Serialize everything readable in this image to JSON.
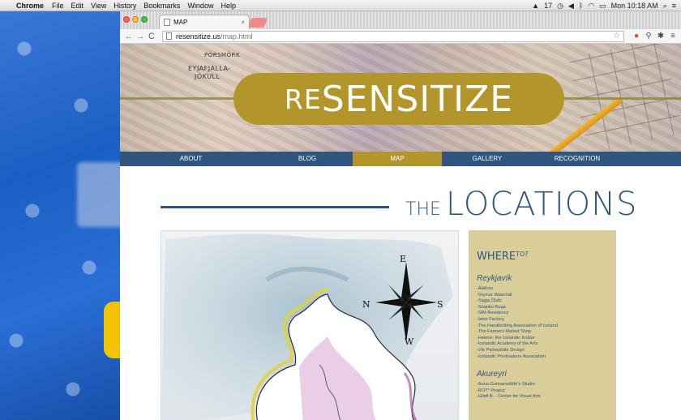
{
  "menubar": {
    "apple_glyph": "",
    "app_name": "Chrome",
    "menus": [
      "File",
      "Edit",
      "View",
      "History",
      "Bookmarks",
      "Window",
      "Help"
    ],
    "status_items": [
      "17",
      "Mon 10:18 AM"
    ]
  },
  "browser": {
    "tab": {
      "title": "MAP",
      "close_glyph": "×"
    },
    "nav": {
      "back": "←",
      "forward": "→",
      "reload": "C"
    },
    "url": {
      "host": "resensitize.us",
      "path": "/map.html"
    },
    "icons": {
      "star": "☆"
    }
  },
  "site": {
    "logo_prefix": "RE",
    "logo_main": "SENSITIZE",
    "banner_map_labels": [
      "PÓRSMÖRK",
      "EYJAFJALLA-",
      "JÖKULL"
    ],
    "nav": [
      "ABOUT",
      "BLOG",
      "MAP",
      "GALLERY",
      "RECOGNITION"
    ],
    "active_nav": "MAP",
    "heading": {
      "the": "THE",
      "title": "LOCATIONS"
    },
    "map_compass": {
      "n": "N",
      "e": "E",
      "s": "S",
      "w": "W"
    },
    "sidebar": {
      "title_main": "WHERE",
      "title_sup": "TO?",
      "sections": [
        {
          "city": "Reykjavík",
          "items": [
            "-Álafoss",
            "-Glymur Waterfall",
            "-Sigga Ólafs",
            "-Shanko Ruga",
            "-SIM Residency",
            "-Ístex Factory",
            "-The Handknitting Association of Iceland",
            "-The Farmers Market Shop",
            "-Helene: the Icelandic Knitter",
            "-Icelandic Academy of the Arts",
            "-Vík Prjónsdóttir Design",
            "-Icelandic Printmakers Association"
          ]
        },
        {
          "city": "Akureyri",
          "items": [
            "-Anna Gunnarsdóttir's Studio",
            "-RÓT* Project",
            "-Gilsfl B. - Center for Visual Arts"
          ]
        }
      ]
    }
  },
  "colors": {
    "navy": "#30557e",
    "gold": "#b3962b",
    "sidebar_bg": "#d9cd99"
  }
}
